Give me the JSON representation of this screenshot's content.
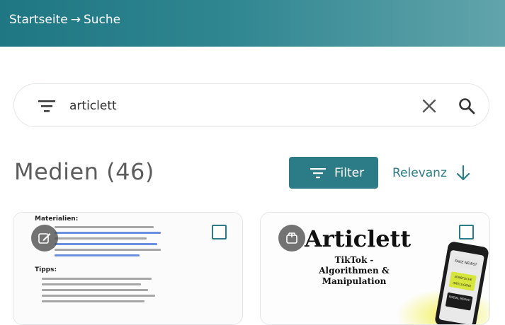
{
  "header": {
    "breadcrumb_home": "Startseite",
    "breadcrumb_separator": "→",
    "breadcrumb_current": "Suche",
    "gradient_colors": [
      "#1f7783",
      "#62a4ab"
    ]
  },
  "search": {
    "value": "articlett",
    "filter_icon": "filter-lines-icon",
    "clear_icon": "close-icon",
    "submit_icon": "search-icon"
  },
  "results": {
    "title": "Medien (46)",
    "filter_button_label": "Filter",
    "sort_label": "Relevanz",
    "sort_icon": "arrow-down-icon",
    "accent_color": "#2b7c86"
  },
  "cards": [
    {
      "type_icon": "edit-icon",
      "doc_heading": "Materialien:",
      "doc_section": "Tipps:",
      "selected": false
    },
    {
      "type_icon": "box-icon",
      "logo_text": "Articlett",
      "subtitle": "TikTok - Algorithmen & Manipulation",
      "phone_labels": [
        "FAKE NEWS?",
        "KÜNSTLICHE INTELLIGENZ",
        "SOZIAL MEDIA?"
      ],
      "selected": false
    }
  ]
}
